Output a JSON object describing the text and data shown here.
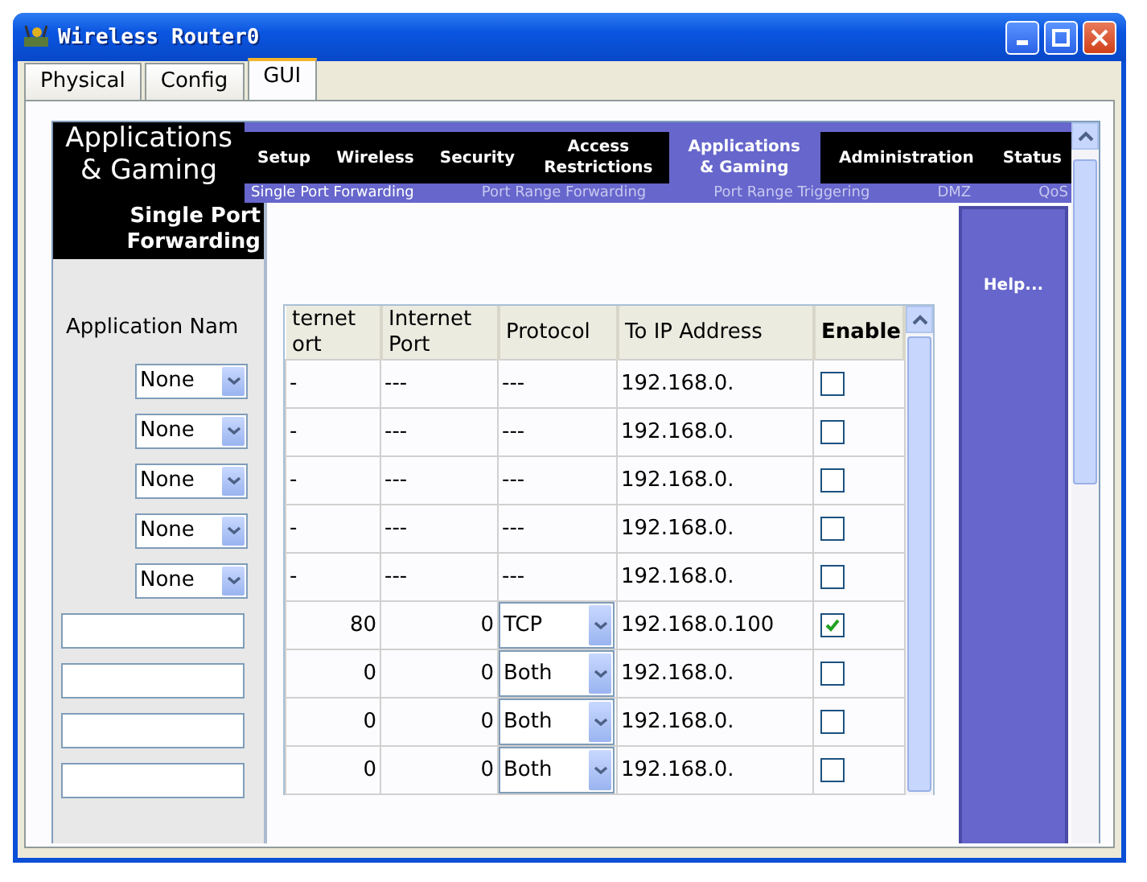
{
  "window": {
    "title": "Wireless Router0"
  },
  "tabs": [
    {
      "label": "Physical",
      "selected": false
    },
    {
      "label": "Config",
      "selected": false
    },
    {
      "label": "GUI",
      "selected": true
    }
  ],
  "header": {
    "section_title": "Applications & Gaming",
    "nav": [
      {
        "label": "Setup",
        "selected": false
      },
      {
        "label": "Wireless",
        "selected": false
      },
      {
        "label": "Security",
        "selected": false
      },
      {
        "label": "Access Restrictions",
        "selected": false
      },
      {
        "label": "Applications & Gaming",
        "selected": true
      },
      {
        "label": "Administration",
        "selected": false
      },
      {
        "label": "Status",
        "selected": false
      }
    ],
    "subnav": [
      {
        "label": "Single Port Forwarding",
        "selected": true
      },
      {
        "label": "Port Range Forwarding",
        "selected": false
      },
      {
        "label": "Port Range Triggering",
        "selected": false
      },
      {
        "label": "DMZ",
        "selected": false
      },
      {
        "label": "QoS",
        "selected": false
      }
    ]
  },
  "sidebar": {
    "title": "Single Port Forwarding",
    "label": "Application Nam",
    "fields": [
      {
        "kind": "select",
        "value": "None"
      },
      {
        "kind": "select",
        "value": "None"
      },
      {
        "kind": "select",
        "value": "None"
      },
      {
        "kind": "select",
        "value": "None"
      },
      {
        "kind": "select",
        "value": "None"
      },
      {
        "kind": "input"
      },
      {
        "kind": "input"
      },
      {
        "kind": "input"
      },
      {
        "kind": "input"
      }
    ]
  },
  "table": {
    "columns": [
      "ternet ort",
      "Internet Port",
      "Protocol",
      "To IP Address",
      "Enable"
    ],
    "rows": [
      {
        "kind": "static",
        "external_port": "-",
        "internal_port": "---",
        "protocol": "---",
        "ip": "192.168.0.",
        "enabled": false
      },
      {
        "kind": "static",
        "external_port": "-",
        "internal_port": "---",
        "protocol": "---",
        "ip": "192.168.0.",
        "enabled": false
      },
      {
        "kind": "static",
        "external_port": "-",
        "internal_port": "---",
        "protocol": "---",
        "ip": "192.168.0.",
        "enabled": false
      },
      {
        "kind": "static",
        "external_port": "-",
        "internal_port": "---",
        "protocol": "---",
        "ip": "192.168.0.",
        "enabled": false
      },
      {
        "kind": "static",
        "external_port": "-",
        "internal_port": "---",
        "protocol": "---",
        "ip": "192.168.0.",
        "enabled": false
      },
      {
        "kind": "editable",
        "external_port": "80",
        "internal_port": "0",
        "protocol": "TCP",
        "ip": "192.168.0.100",
        "enabled": true
      },
      {
        "kind": "editable",
        "external_port": "0",
        "internal_port": "0",
        "protocol": "Both",
        "ip": "192.168.0.",
        "enabled": false
      },
      {
        "kind": "editable",
        "external_port": "0",
        "internal_port": "0",
        "protocol": "Both",
        "ip": "192.168.0.",
        "enabled": false
      },
      {
        "kind": "editable",
        "external_port": "0",
        "internal_port": "0",
        "protocol": "Both",
        "ip": "192.168.0.",
        "enabled": false
      }
    ]
  },
  "help": {
    "label": "Help..."
  }
}
